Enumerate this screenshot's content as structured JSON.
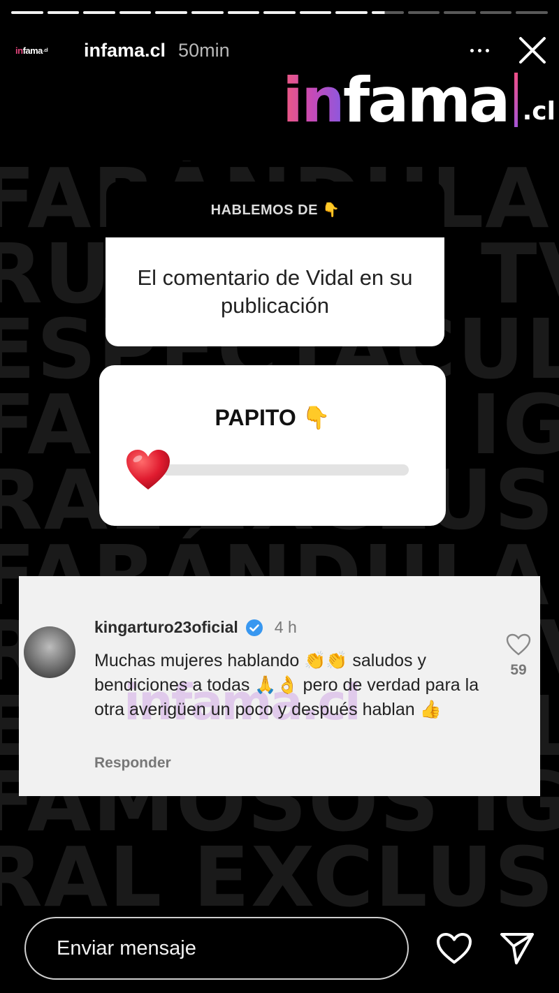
{
  "progress": {
    "total_segments": 15,
    "completed_segments": 10,
    "current_segment_progress": 0.4
  },
  "header": {
    "account": "infama.cl",
    "time": "50min",
    "avatar_text_in": "in",
    "avatar_text_rest": "fama",
    "avatar_text_tld": ".cl"
  },
  "logo": {
    "part_in": "in",
    "part_rest": "fama",
    "tld": ".cl"
  },
  "background_words": [
    "FARÁNDULA FARÁNDULA",
    "RUMORES TV RUMORES TV",
    "ESPECTÁCULOS ESPECTÁCULOS",
    "FAMOSOS IG FAMOSOS IG",
    "RAL EXCLUSIV RAL EXCLUSIV",
    "FARÁNDULA FARÁNDULA",
    "RUMORES TV RUMORES TV",
    "ESPECTÁCULOS ESPECTÁCULOS",
    "FAMOSOS IG FAMOSOS IG",
    "RAL EXCLUSIV RAL EXCLUSIV"
  ],
  "question_card": {
    "header": "HABLEMOS DE 👇",
    "body": "El comentario de Vidal en su publicación"
  },
  "slider": {
    "title": "PAPITO 👇",
    "emoji": "❤️",
    "value": 0.0
  },
  "comment": {
    "username": "kingarturo23oficial",
    "time": "4 h",
    "text": "Muchas mujeres hablando 👏👏 saludos y bendiciones a todas 🙏👌 pero de verdad para la otra averigüen un poco y después hablan 👍",
    "reply_label": "Responder",
    "likes": "59",
    "watermark": "infama.cl"
  },
  "footer": {
    "message_placeholder": "Enviar mensaje"
  },
  "colors": {
    "accent_pink": "#ef4f86",
    "accent_purple": "#a655d4",
    "heart_red": "#e01b2f",
    "verified_blue": "#3897f0"
  }
}
